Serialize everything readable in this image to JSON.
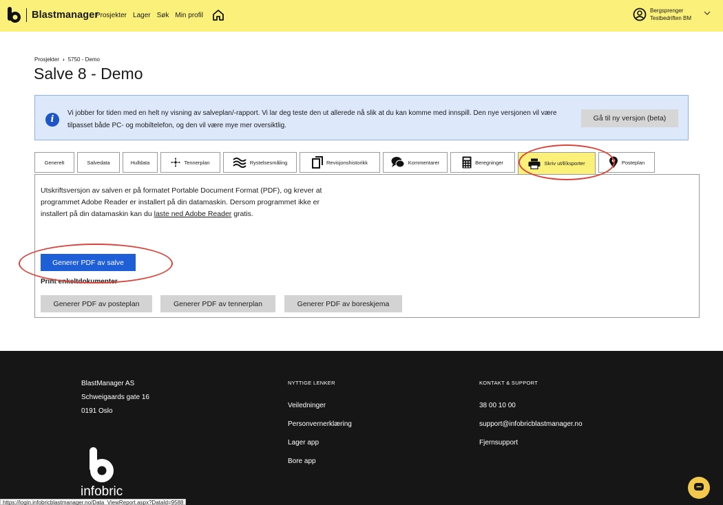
{
  "header": {
    "brand": "Blastmanager",
    "nav": [
      "Prosjekter",
      "Lager",
      "Søk",
      "Min profil"
    ],
    "user": {
      "name": "Bergsprenger",
      "company": "Testbedriften BM"
    }
  },
  "breadcrumb": {
    "root": "Prosjekter",
    "project": "5750 - Demo"
  },
  "page_title": "Salve 8 - Demo",
  "info_banner": {
    "text": "Vi jobber for tiden med en helt ny visning av salveplan/-rapport. Vi lar deg teste den ut allerede nå slik at du kan komme med innspill. Den nye versjonen vil være tilpasset både PC- og mobiltelefon, og den vil være mye mer oversiktlig.",
    "button": "Gå til ny versjon (beta)"
  },
  "tabs": [
    {
      "label": "Generelt",
      "icon": ""
    },
    {
      "label": "Salvedata",
      "icon": ""
    },
    {
      "label": "Hulldata",
      "icon": ""
    },
    {
      "label": "Tennerplan",
      "icon": "network-icon"
    },
    {
      "label": "Rystelsesmåling",
      "icon": "wave-icon"
    },
    {
      "label": "Revisjonshistorikk",
      "icon": "copy-icon"
    },
    {
      "label": "Kommentarer",
      "icon": "chat-icon"
    },
    {
      "label": "Beregninger",
      "icon": "calculator-icon"
    },
    {
      "label": "Skriv ut/Eksporter",
      "icon": "printer-icon",
      "active": true
    },
    {
      "label": "Posteplan",
      "icon": "map-pin-icon"
    }
  ],
  "panel": {
    "text_before_link": "Utskriftsversjon av salven er på formatet Portable Document Format (PDF), og krever at programmet Adobe Reader er installert på din datamaskin. Dersom programmet ikke er installert på din datamaskin kan du ",
    "link": "laste ned Adobe Reader",
    "text_after_link": " gratis.",
    "primary_button": "Generer PDF av salve",
    "single_docs_label": "Print enkeltdokumenter",
    "secondary_buttons": [
      "Generer PDF av posteplan",
      "Generer PDF av tennerplan",
      "Generer PDF av boreskjema"
    ]
  },
  "footer": {
    "company": [
      "BlastManager AS",
      "Schweigaards gate 16",
      "0191 Oslo"
    ],
    "useful_links_heading": "NYTTIGE LENKER",
    "useful_links": [
      "Veiledninger",
      "Personvernerklæring",
      "Lager app",
      "Bore app"
    ],
    "contact_heading": "KONTAKT & SUPPORT",
    "contact": [
      "38 00 10 00",
      "support@infobricblastmanager.no",
      "Fjernsupport"
    ],
    "logo_text": "infobric"
  },
  "status_url": "https://login.infobricblastmanager.no/Data_ViewReport.aspx?DataId=9588",
  "colors": {
    "topbar": "#fbf07a",
    "primary": "#1e5fd8",
    "annotation": "#d9443a",
    "footer": "#161616"
  }
}
